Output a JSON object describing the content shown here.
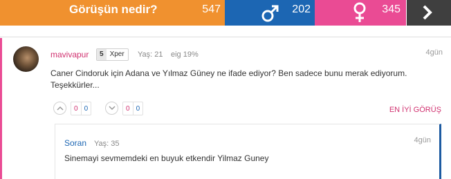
{
  "poll": {
    "question": "Görüşün nedir?",
    "total": "547",
    "male_count": "202",
    "female_count": "345"
  },
  "post": {
    "username": "mavivapur",
    "xper_level": "5",
    "xper_label": "Xper",
    "age": "Yaş: 21",
    "extra": "eig 19%",
    "time": "4gün",
    "text": "Caner Cindoruk için Adana ve Yılmaz Güney ne ifade ediyor? Ben sadece bunu merak ediyorum. Teşekkürler...",
    "up_votes": "0",
    "up_votes_2": "0",
    "down_votes": "0",
    "down_votes_2": "0",
    "best_label": "EN İYİ GÖRÜŞ"
  },
  "reply": {
    "username": "Soran",
    "age": "Yaş: 35",
    "time": "4gün",
    "text": "Sinemayi sevmemdeki en buyuk etkendir Yilmaz Guney"
  },
  "colors": {
    "orange": "#f0912f",
    "blue": "#1c66b3",
    "pink": "#ea4b94",
    "dark": "#3f3f3f"
  },
  "icons": [
    "male-icon",
    "female-icon",
    "chevron-right-icon",
    "thumb-up-icon",
    "thumb-down-icon"
  ]
}
